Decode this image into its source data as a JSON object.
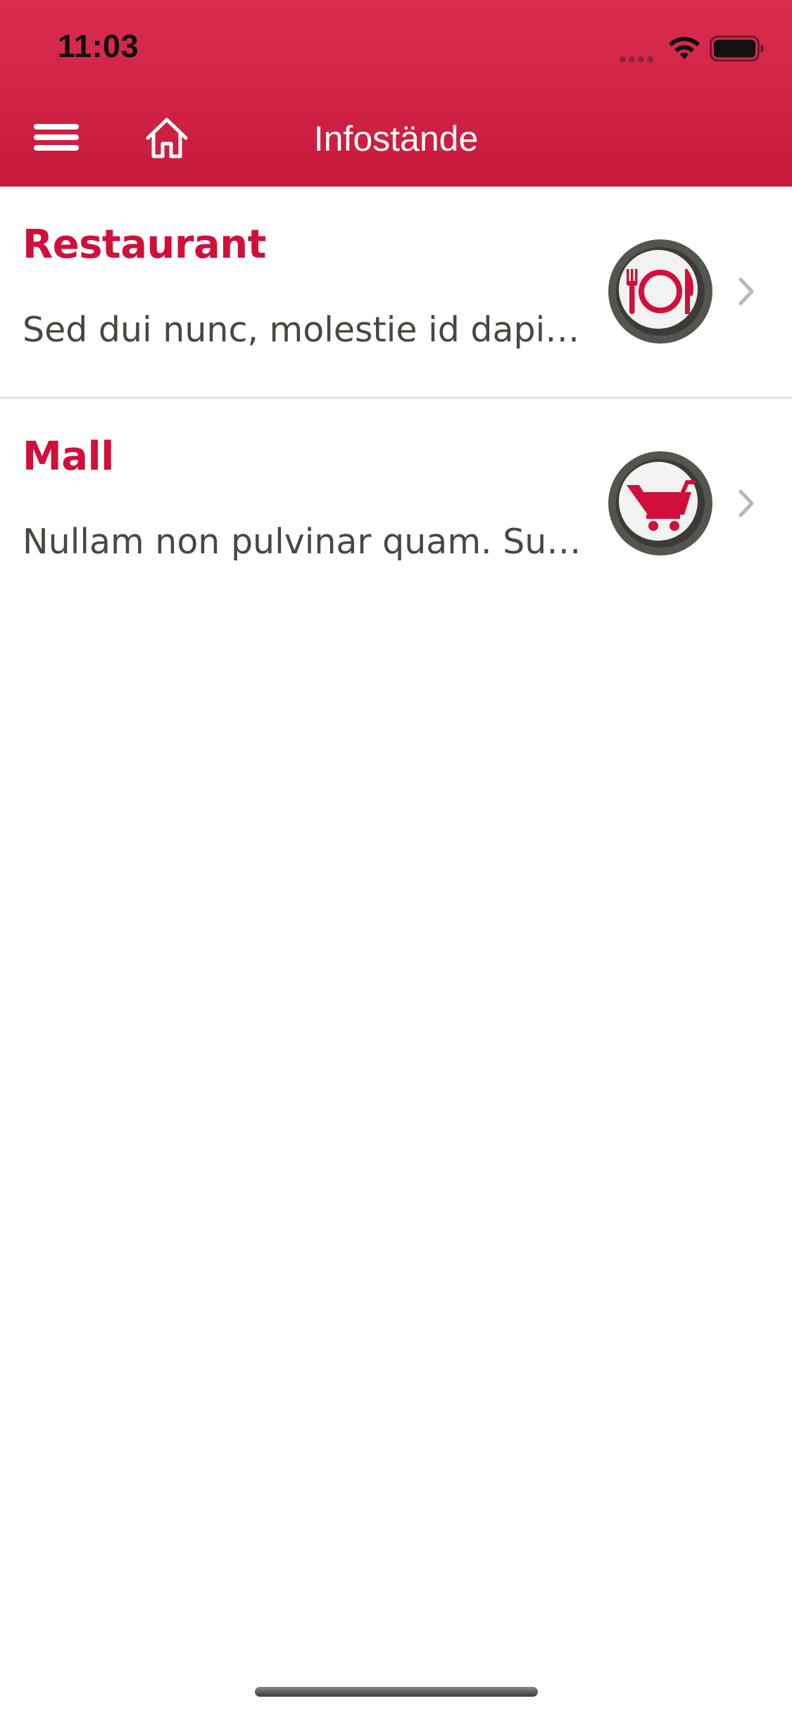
{
  "status_bar": {
    "time": "11:03",
    "icons": [
      "signal-dots-icon",
      "wifi-icon",
      "battery-icon"
    ]
  },
  "nav_bar": {
    "title": "Infostände",
    "left_icons": [
      "hamburger-menu-icon",
      "home-icon"
    ],
    "background_color": "#cf2145"
  },
  "list": {
    "items": [
      {
        "title": "Restaurant",
        "subtitle": "Sed dui nunc, molestie id dapib...",
        "icon": "plate-cutlery-icon"
      },
      {
        "title": "Mall",
        "subtitle": "Nullam non pulvinar quam. Susp...",
        "icon": "shopping-cart-icon"
      }
    ]
  },
  "colors": {
    "accent": "#d0103a",
    "subtitle_text": "#4a4640",
    "divider": "#d8d8d8",
    "chevron": "#b8b8b8"
  }
}
